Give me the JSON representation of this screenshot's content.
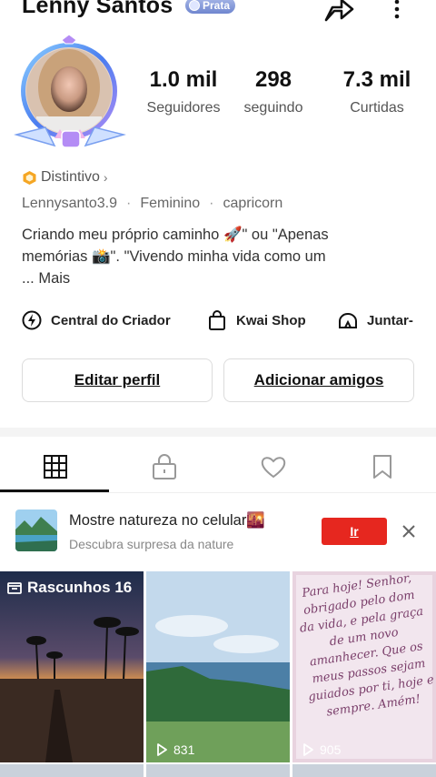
{
  "header": {
    "name": "Lenny Santos",
    "badge": "Prata"
  },
  "stats": [
    {
      "value": "1.0 mil",
      "label": "Seguidores"
    },
    {
      "value": "298",
      "label": "seguindo"
    },
    {
      "value": "7.3 mil",
      "label": "Curtidas"
    }
  ],
  "profile": {
    "distintivo": "Distintivo",
    "username": "Lennysanto3.9",
    "gender": "Feminino",
    "sign": "capricorn",
    "bio_line1": "Criando meu próprio caminho 🚀\" ou \"Apenas",
    "bio_line2": "memórias 📸\". \"Vivendo minha vida como um",
    "bio_more_prefix": "... ",
    "bio_more": "Mais"
  },
  "quicklinks": [
    {
      "label": "Central do Criador",
      "icon": "bolt-icon"
    },
    {
      "label": "Kwai Shop",
      "icon": "bag-icon"
    },
    {
      "label": "Juntar-",
      "icon": "tent-icon"
    }
  ],
  "actions": {
    "edit": "Editar perfil",
    "add": "Adicionar amigos"
  },
  "tabs": [
    "grid-icon",
    "lock-icon",
    "heart-icon",
    "bookmark-icon"
  ],
  "banner": {
    "title": "Mostre natureza no celular🌇",
    "subtitle": "Descubra surpresa da nature",
    "button": "Ir"
  },
  "grid": {
    "drafts_label": "Rascunhos 16",
    "views_2": "831",
    "views_3": "905",
    "handwritten": "Para hoje! Senhor, obrigado pelo dom da vida, e pela graça de um novo amanhecer. Que os meus passos sejam guiados por ti, hoje e sempre. Amém!"
  },
  "colors": {
    "accent_red": "#e6271f",
    "badge_blue": "#6f86cf"
  }
}
